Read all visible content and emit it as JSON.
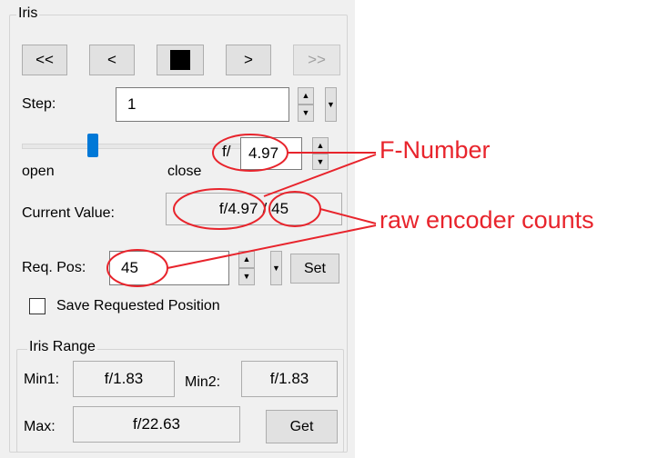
{
  "iris_group": {
    "title": "Iris",
    "nav_buttons": [
      "<<",
      "<",
      ">",
      ">>"
    ],
    "step_label": "Step:",
    "step_value": "1",
    "slider_left_label": "open",
    "slider_right_label": "close",
    "fnumber_prefix": "f/",
    "fnumber_value": "4.97",
    "current_value_label": "Current Value:",
    "current_fnumber": "f/4.97",
    "current_separator": "/",
    "current_counts": "45",
    "req_pos_label": "Req. Pos:",
    "req_pos_value": "45",
    "set_button": "Set",
    "save_checkbox_label": "Save Requested Position",
    "save_checked": false
  },
  "range_group": {
    "title": "Iris Range",
    "min1_label": "Min1:",
    "min1_value": "f/1.83",
    "min2_label": "Min2:",
    "min2_value": "f/1.83",
    "max_label": "Max:",
    "max_value": "f/22.63",
    "get_button": "Get"
  },
  "annotations": {
    "fnumber": "F-Number",
    "counts": "raw encoder counts",
    "color": "#e8242c"
  },
  "colors": {
    "panel_bg": "#f0f0f0",
    "slider_thumb": "#0078d7"
  }
}
